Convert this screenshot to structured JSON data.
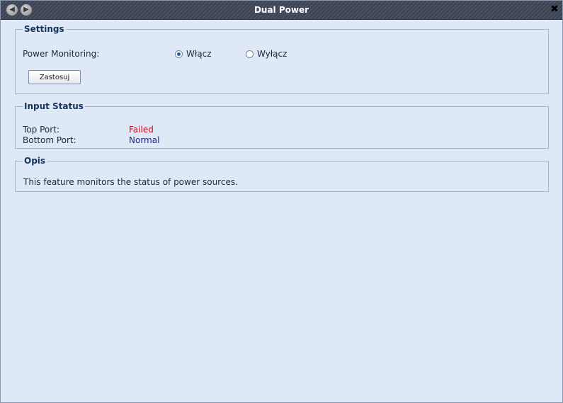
{
  "window": {
    "title": "Dual Power",
    "back_icon": "arrow-left-icon",
    "forward_icon": "arrow-right-icon",
    "close_icon": "close-icon",
    "close_glyph": "✖"
  },
  "settings": {
    "legend": "Settings",
    "power_monitoring_label": "Power Monitoring:",
    "options": [
      {
        "label": "Włącz",
        "selected": true
      },
      {
        "label": "Wyłącz",
        "selected": false
      }
    ],
    "apply_label": "Zastosuj"
  },
  "input_status": {
    "legend": "Input Status",
    "rows": [
      {
        "label": "Top Port:",
        "value": "Failed",
        "color": "#d0021b"
      },
      {
        "label": "Bottom Port:",
        "value": "Normal",
        "color": "#1a2a8a"
      }
    ]
  },
  "opis": {
    "legend": "Opis",
    "text": "This feature monitors the status of power sources."
  }
}
